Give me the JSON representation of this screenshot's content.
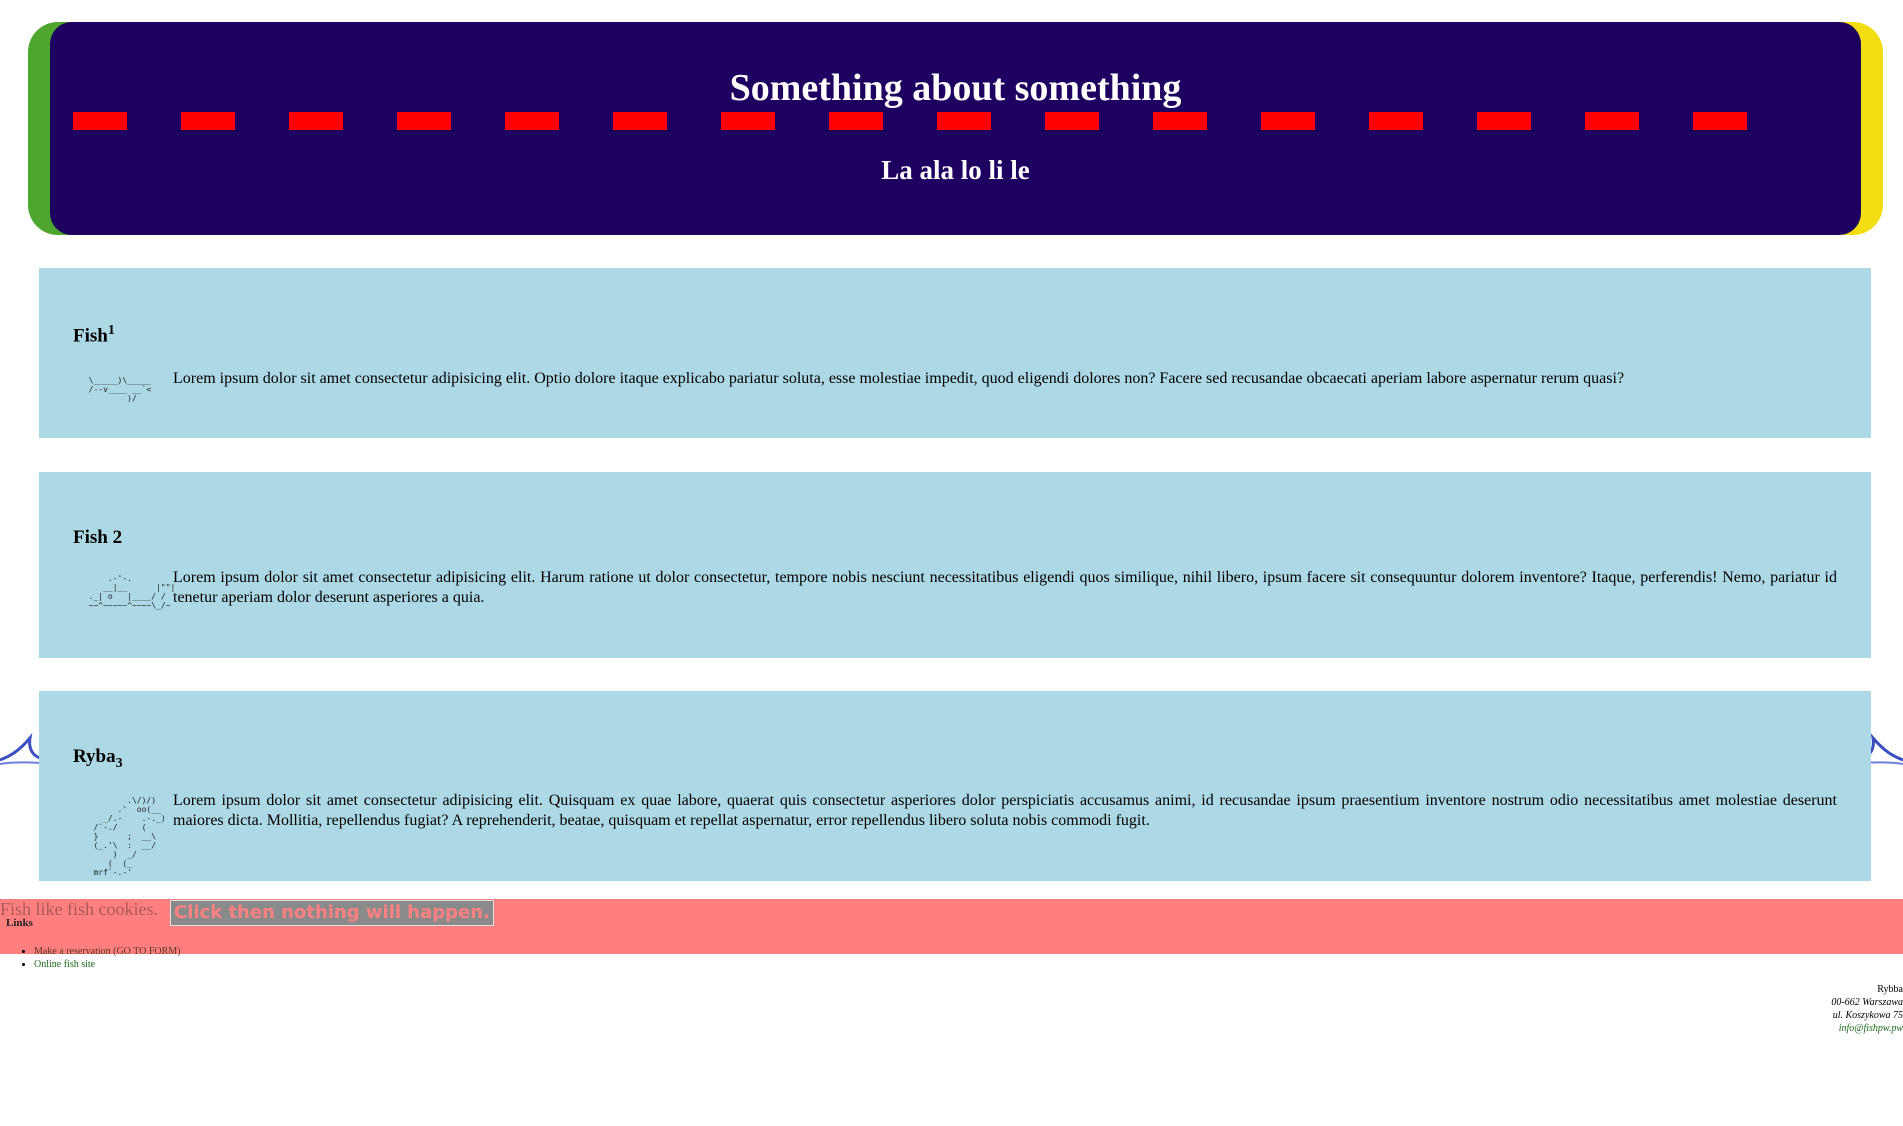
{
  "header": {
    "title": "Something about something",
    "subtitle": "La ala lo li le",
    "colors": {
      "background": "#1e0061",
      "left_accent": "#4ea62e",
      "right_accent": "#f2de12",
      "dash": "#ff0000"
    }
  },
  "cards": [
    {
      "heading": "Fish",
      "heading_suffix": "1",
      "ascii_art": "  \\_____)\\_____\n  /--v____ __`<\n          )/",
      "text": "Lorem ipsum dolor sit amet consectetur adipisicing elit. Optio dolore itaque explicabo pariatur soluta, esse molestiae impedit, quod eligendi dolores non? Facere sed recusandae obcaecati aperiam labore aspernatur rerum quasi?"
    },
    {
      "heading": "Fish 2",
      "ascii_art": "      .-'-.\n     __|__      |\"\"|\n  ._| o   |____/ /\n  ~~^~~~~~^~~~~\\_/~",
      "text": "Lorem ipsum dolor sit amet consectetur adipisicing elit. Harum ratione ut dolor consectetur, tempore nobis nesciunt necessitatibus eligendi quos similique, nihil libero, ipsum facere sit consequuntur dolorem inventore? Itaque, perferendis! Nemo, pariatur id tenetur aperiam dolor deserunt asperiores a quia."
    },
    {
      "heading": "Ryba",
      "heading_suffix": "3",
      "ascii_art": "          .\\/)/)\n        .'  oo(__\n     _/.-    .-._)\n   /`-./     (\n   }      ;  __\\\n   (_.'\\  :  __/\n       )  _/\n      (  (_\n   mrf`-.-'",
      "text": "Lorem ipsum dolor sit amet consectetur adipisicing elit. Quisquam ex quae labore, quaerat quis consectetur asperiores dolor perspiciatis accusamus animi, id recusandae ipsum praesentium inventore nostrum odio necessitatibus amet molestiae deserunt maiores dicta. Mollitia, repellendus fugiat? A reprehenderit, beatae, quisquam et repellat aspernatur, error repellendus libero soluta nobis commodi fugit."
    }
  ],
  "cookie": {
    "text": "Fish like fish cookies.",
    "button_label": "Click then nothing will happen."
  },
  "links": {
    "title": "Links",
    "items": [
      {
        "label": "Make a reservation (GO TO FORM)"
      },
      {
        "label": "Online fish site"
      }
    ]
  },
  "address": {
    "name": "Rybba",
    "line1": "00-662 Warszawa",
    "line2": "ul. Koszykowa 75",
    "email": "info@fishpw.pw"
  }
}
